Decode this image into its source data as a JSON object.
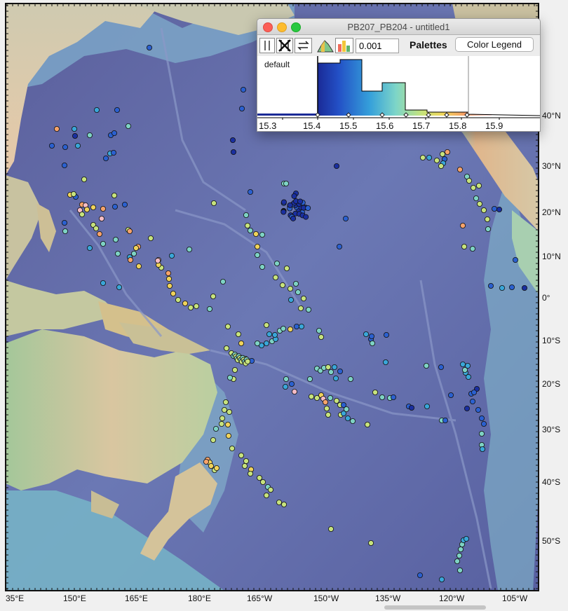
{
  "window": {
    "title": "PB207_PB204 - untitled1",
    "value": "0.001",
    "palettes_label": "Palettes",
    "legend_button": "Color Legend",
    "palette_name": "default",
    "axis_ticks": [
      "15.3",
      "15.4",
      "15.5",
      "15.6",
      "15.7",
      "15.8",
      "15.9"
    ]
  },
  "map": {
    "lat_labels": [
      "40°N",
      "30°N",
      "20°N",
      "10°N",
      "0°",
      "10°S",
      "20°S",
      "30°S",
      "40°S",
      "50°S"
    ],
    "lon_labels": [
      "35°E",
      "150°E",
      "165°E",
      "180°E",
      "165°W",
      "150°W",
      "135°W",
      "120°W",
      "105°W"
    ]
  },
  "colors": {
    "ocean_deep": "#5d63a0",
    "ocean_mid": "#7080b8",
    "shelf": "#79bfcf",
    "land": "#d3c2a3",
    "low_land": "#94c49c",
    "palette": [
      "#1a2fa0",
      "#2b60cf",
      "#3aa6d8",
      "#7ed3c4",
      "#c7e37e",
      "#f0d35b",
      "#f6a36b",
      "#f5bcc6"
    ]
  },
  "samples": {
    "marker_color_classes": "palette index 0-7",
    "count_note": ""
  }
}
